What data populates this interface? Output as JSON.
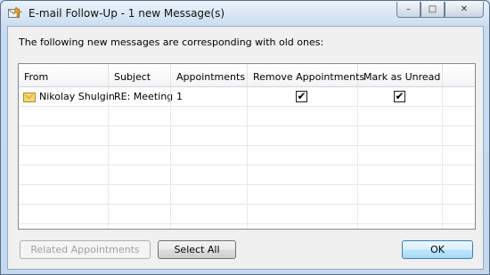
{
  "window": {
    "title": "E-mail Follow-Up - 1 new Message(s)",
    "title_icon": "email-followup-icon",
    "caption_buttons": {
      "minimize": "–",
      "maximize": "□",
      "close": "✕"
    }
  },
  "intro_text": "The following new messages are corresponding with old ones:",
  "grid": {
    "columns": [
      "From",
      "Subject",
      "Appointments",
      "Remove Appointments",
      "Mark as Unread"
    ],
    "rows": [
      {
        "from": "Nikolay Shulgin",
        "subject": "RE: Meeting",
        "appointments": "1",
        "remove_appointments": true,
        "mark_as_unread": true
      }
    ]
  },
  "buttons": {
    "related_appointments": "Related Appointments",
    "select_all": "Select All",
    "ok": "OK"
  },
  "check_glyph": "✔"
}
